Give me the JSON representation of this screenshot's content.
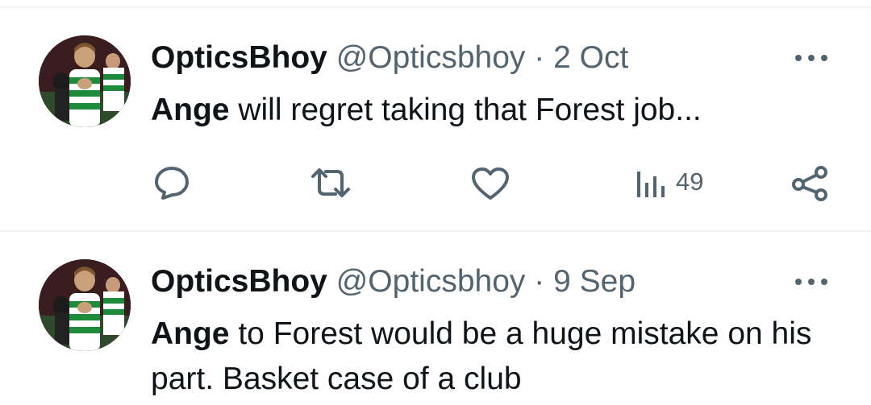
{
  "tweets": [
    {
      "name": "OpticsBhoy",
      "handle": "@Opticsbhoy",
      "separator": "·",
      "date": "2 Oct",
      "text_bold": "Ange",
      "text_rest": " will regret taking that Forest job...",
      "views": "49",
      "has_actions": true
    },
    {
      "name": "OpticsBhoy",
      "handle": "@Opticsbhoy",
      "separator": "·",
      "date": "9 Sep",
      "text_bold": "Ange",
      "text_rest": " to Forest would be a huge mistake on his part. Basket case of a club",
      "has_actions": false
    }
  ],
  "icons": {
    "more": "more-horizontal-icon",
    "reply": "reply-icon",
    "retweet": "retweet-icon",
    "like": "heart-icon",
    "views": "views-icon",
    "share": "share-icon"
  },
  "colors": {
    "text_primary": "#0f1419",
    "text_secondary": "#536471",
    "divider": "#eff3f4",
    "background": "#ffffff"
  }
}
